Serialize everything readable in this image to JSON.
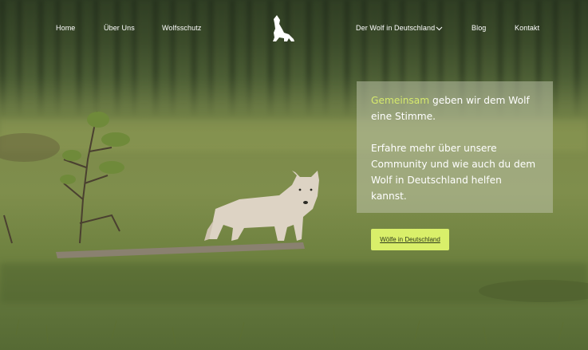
{
  "nav": {
    "items": [
      {
        "label": "Home"
      },
      {
        "label": "Über Uns"
      },
      {
        "label": "Wolfsschutz"
      },
      {
        "label": "Der Wolf in Deutschland"
      },
      {
        "label": "Blog"
      },
      {
        "label": "Kontakt"
      }
    ],
    "logo_icon": "howling-wolf-icon"
  },
  "hero": {
    "headline_accent": "Gemeinsam",
    "headline_rest": " geben wir dem Wolf eine Stimme.",
    "body": "Erfahre mehr über unsere Community und wie auch du dem Wolf in Deutschland helfen kannst.",
    "cta_label": "Wölfe in Deutschland"
  },
  "colors": {
    "accent": "#d6ea6c",
    "button": "#d9ef6a"
  }
}
